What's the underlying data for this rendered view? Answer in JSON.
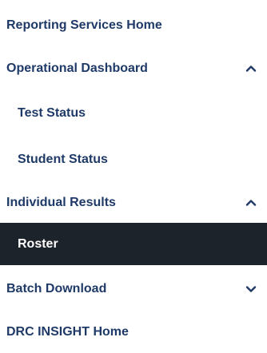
{
  "nav": {
    "reporting_home": "Reporting Services Home",
    "operational_dashboard": {
      "label": "Operational Dashboard",
      "chevron": "chevron-up-icon",
      "children": [
        "Test Status",
        "Student Status"
      ]
    },
    "individual_results": {
      "label": "Individual Results",
      "chevron": "chevron-up-icon",
      "children": [
        "Roster"
      ]
    },
    "batch_download": {
      "label": "Batch Download",
      "chevron": "chevron-down-icon"
    },
    "drc_insight_home": "DRC INSIGHT Home"
  },
  "colors": {
    "text": "#1f3a67",
    "active_bg": "#1d232b",
    "active_text": "#ffffff",
    "background": "#ffffff"
  }
}
